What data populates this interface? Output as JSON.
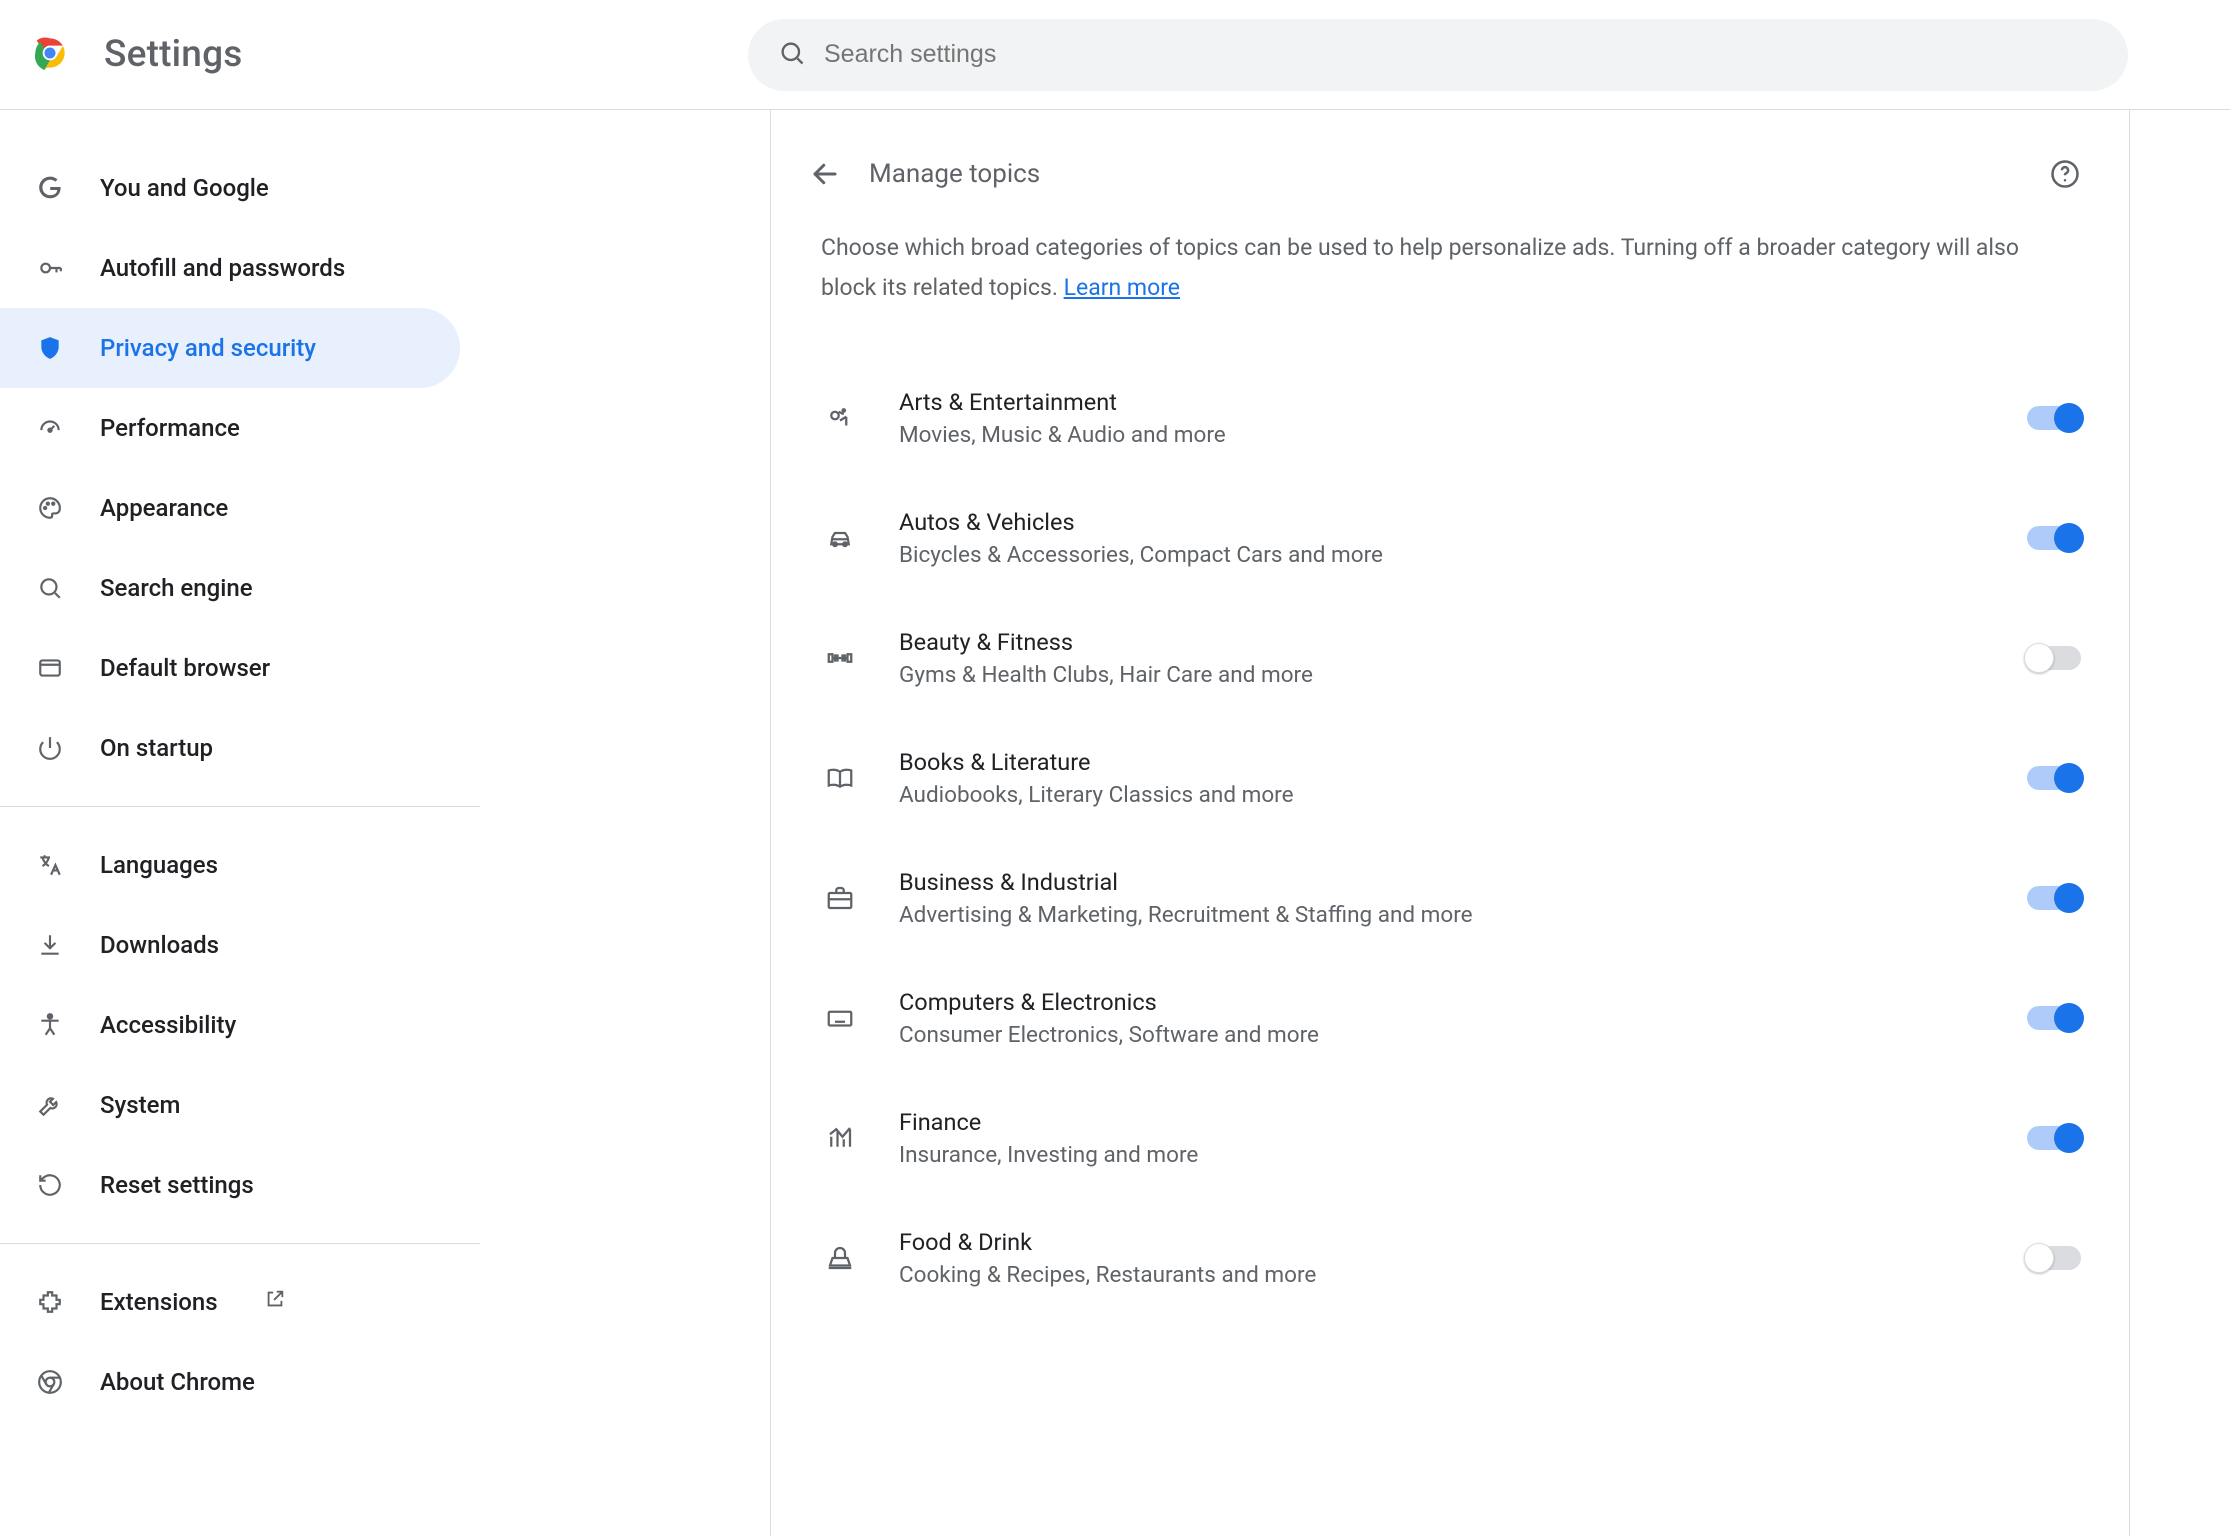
{
  "app": {
    "title": "Settings"
  },
  "search": {
    "placeholder": "Search settings"
  },
  "sidebar": {
    "groups": [
      [
        {
          "id": "you-and-google",
          "label": "You and Google",
          "icon": "g-logo"
        },
        {
          "id": "autofill",
          "label": "Autofill and passwords",
          "icon": "key"
        },
        {
          "id": "privacy",
          "label": "Privacy and security",
          "icon": "shield",
          "active": true
        },
        {
          "id": "performance",
          "label": "Performance",
          "icon": "speed"
        },
        {
          "id": "appearance",
          "label": "Appearance",
          "icon": "palette"
        },
        {
          "id": "search-engine",
          "label": "Search engine",
          "icon": "search"
        },
        {
          "id": "default-browser",
          "label": "Default browser",
          "icon": "browser"
        },
        {
          "id": "startup",
          "label": "On startup",
          "icon": "power"
        }
      ],
      [
        {
          "id": "languages",
          "label": "Languages",
          "icon": "translate"
        },
        {
          "id": "downloads",
          "label": "Downloads",
          "icon": "download"
        },
        {
          "id": "accessibility",
          "label": "Accessibility",
          "icon": "accessibility"
        },
        {
          "id": "system",
          "label": "System",
          "icon": "wrench"
        },
        {
          "id": "reset",
          "label": "Reset settings",
          "icon": "reset"
        }
      ],
      [
        {
          "id": "extensions",
          "label": "Extensions",
          "icon": "extension",
          "external": true
        },
        {
          "id": "about",
          "label": "About Chrome",
          "icon": "chrome"
        }
      ]
    ]
  },
  "page": {
    "title": "Manage topics",
    "intro_a": "Choose which broad categories of topics can be used to help personalize ads. Turning off a broader category will also block its related topics. ",
    "learn_more": "Learn more"
  },
  "topics": [
    {
      "id": "arts",
      "title": "Arts & Entertainment",
      "sub": "Movies, Music & Audio and more",
      "icon": "arts",
      "on": true
    },
    {
      "id": "autos",
      "title": "Autos & Vehicles",
      "sub": "Bicycles & Accessories, Compact Cars and more",
      "icon": "car",
      "on": true
    },
    {
      "id": "beauty",
      "title": "Beauty & Fitness",
      "sub": "Gyms & Health Clubs, Hair Care and more",
      "icon": "fitness",
      "on": false
    },
    {
      "id": "books",
      "title": "Books & Literature",
      "sub": "Audiobooks, Literary Classics and more",
      "icon": "book",
      "on": true
    },
    {
      "id": "business",
      "title": "Business & Industrial",
      "sub": "Advertising & Marketing, Recruitment & Staffing and more",
      "icon": "briefcase",
      "on": true
    },
    {
      "id": "computers",
      "title": "Computers & Electronics",
      "sub": "Consumer Electronics, Software and more",
      "icon": "keyboard",
      "on": true
    },
    {
      "id": "finance",
      "title": "Finance",
      "sub": "Insurance, Investing and more",
      "icon": "finance",
      "on": true
    },
    {
      "id": "food",
      "title": "Food & Drink",
      "sub": "Cooking & Recipes, Restaurants and more",
      "icon": "food",
      "on": false
    }
  ]
}
